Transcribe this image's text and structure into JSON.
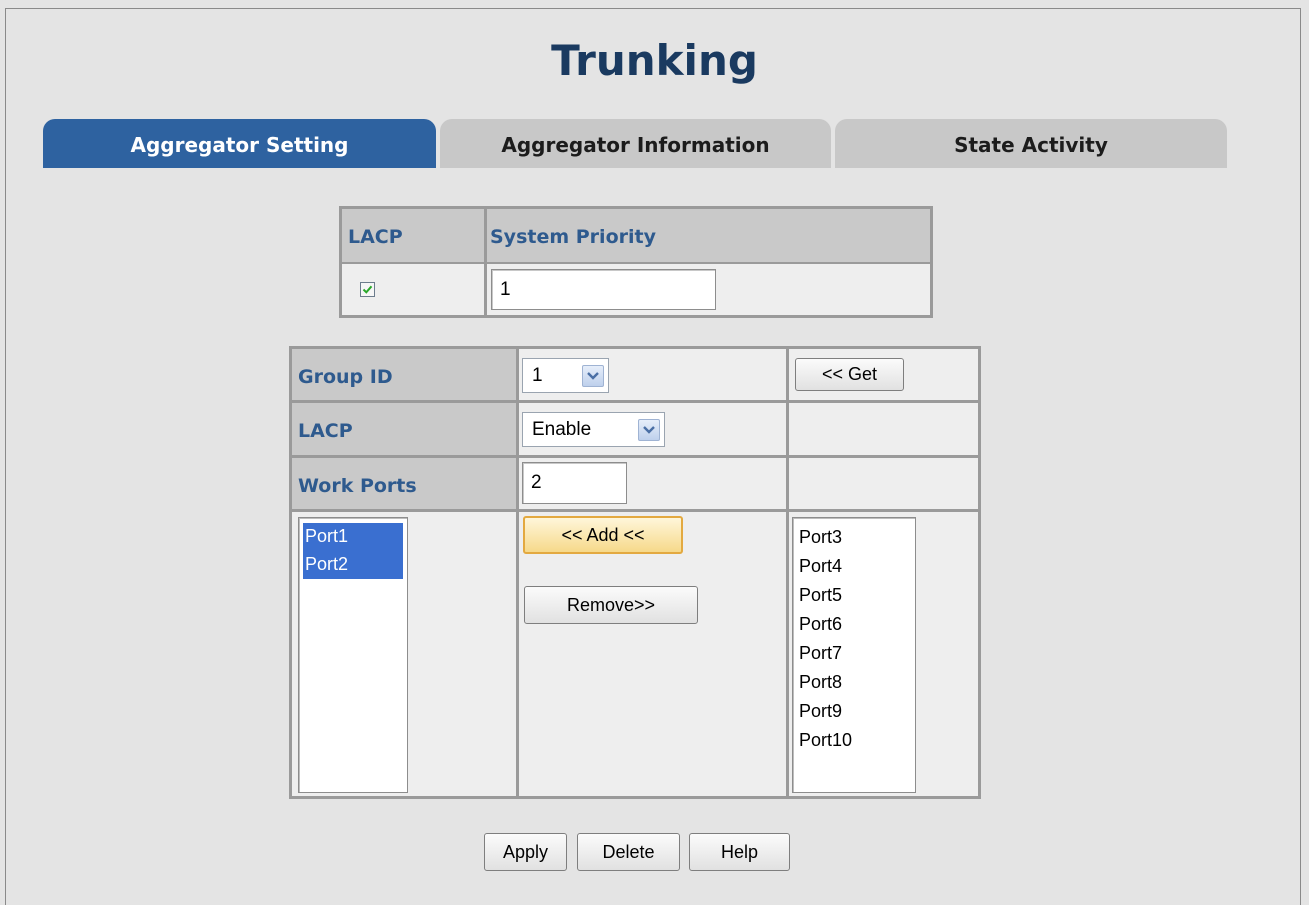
{
  "page": {
    "title": "Trunking"
  },
  "tabs": [
    {
      "label": "Aggregator Setting",
      "active": true
    },
    {
      "label": "Aggregator Information",
      "active": false
    },
    {
      "label": "State Activity",
      "active": false
    }
  ],
  "system": {
    "lacp_header": "LACP",
    "priority_header": "System Priority",
    "lacp_checked": true,
    "priority_value": "1"
  },
  "group": {
    "group_id_label": "Group ID",
    "group_id_value": "1",
    "get_button": "<< Get",
    "lacp_label": "LACP",
    "lacp_value": "Enable",
    "work_ports_label": "Work Ports",
    "work_ports_value": "2",
    "add_button": "<< Add <<",
    "remove_button": "Remove>>",
    "member_ports": [
      "Port1",
      "Port2"
    ],
    "available_ports": [
      "Port3",
      "Port4",
      "Port5",
      "Port6",
      "Port7",
      "Port8",
      "Port9",
      "Port10"
    ]
  },
  "actions": {
    "apply": "Apply",
    "delete": "Delete",
    "help": "Help"
  },
  "colors": {
    "active_tab": "#2e62a0",
    "label_text": "#2e5a8e",
    "title": "#1a3a60"
  }
}
